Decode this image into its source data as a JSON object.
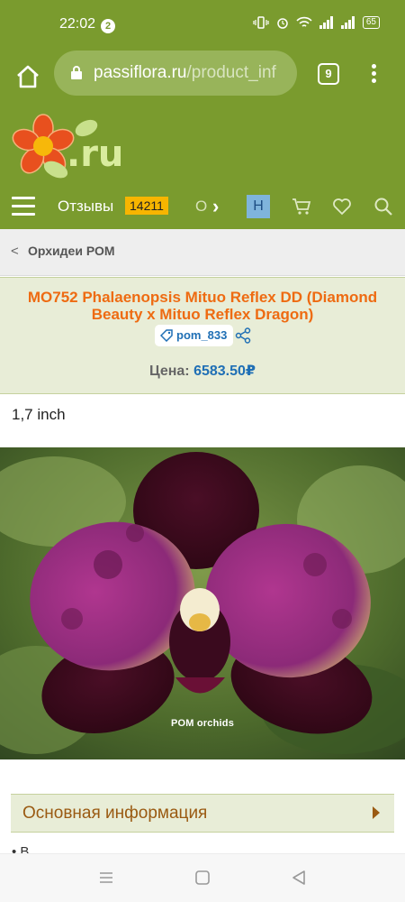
{
  "status_bar": {
    "time": "22:02",
    "notification_count": "2",
    "battery": "65"
  },
  "browser": {
    "url_domain": "passiflora.ru",
    "url_path": "/product_inf",
    "tab_count": "9"
  },
  "site": {
    "logo_text": ".ru",
    "nav": {
      "reviews_label": "Отзывы",
      "reviews_count": "14211",
      "next_item_partial": "О",
      "language": "Н"
    }
  },
  "breadcrumb": {
    "label": "Орхидеи РОМ"
  },
  "product": {
    "title": "MO752 Phalaenopsis Mituo Reflex DD (Diamond Beauty x Mituo Reflex Dragon)",
    "sku": "pom_833",
    "price_label": "Цена:",
    "price_value": "6583.50₽",
    "size": "1,7 inch",
    "photo_watermark": "POM orchids"
  },
  "info_section": {
    "title": "Основная информация",
    "next_text_partial": "• В"
  },
  "colors": {
    "theme_green": "#7a9b2e",
    "title_orange": "#ee6b12",
    "price_blue": "#1f6fb5",
    "section_brown": "#9a5a12"
  }
}
